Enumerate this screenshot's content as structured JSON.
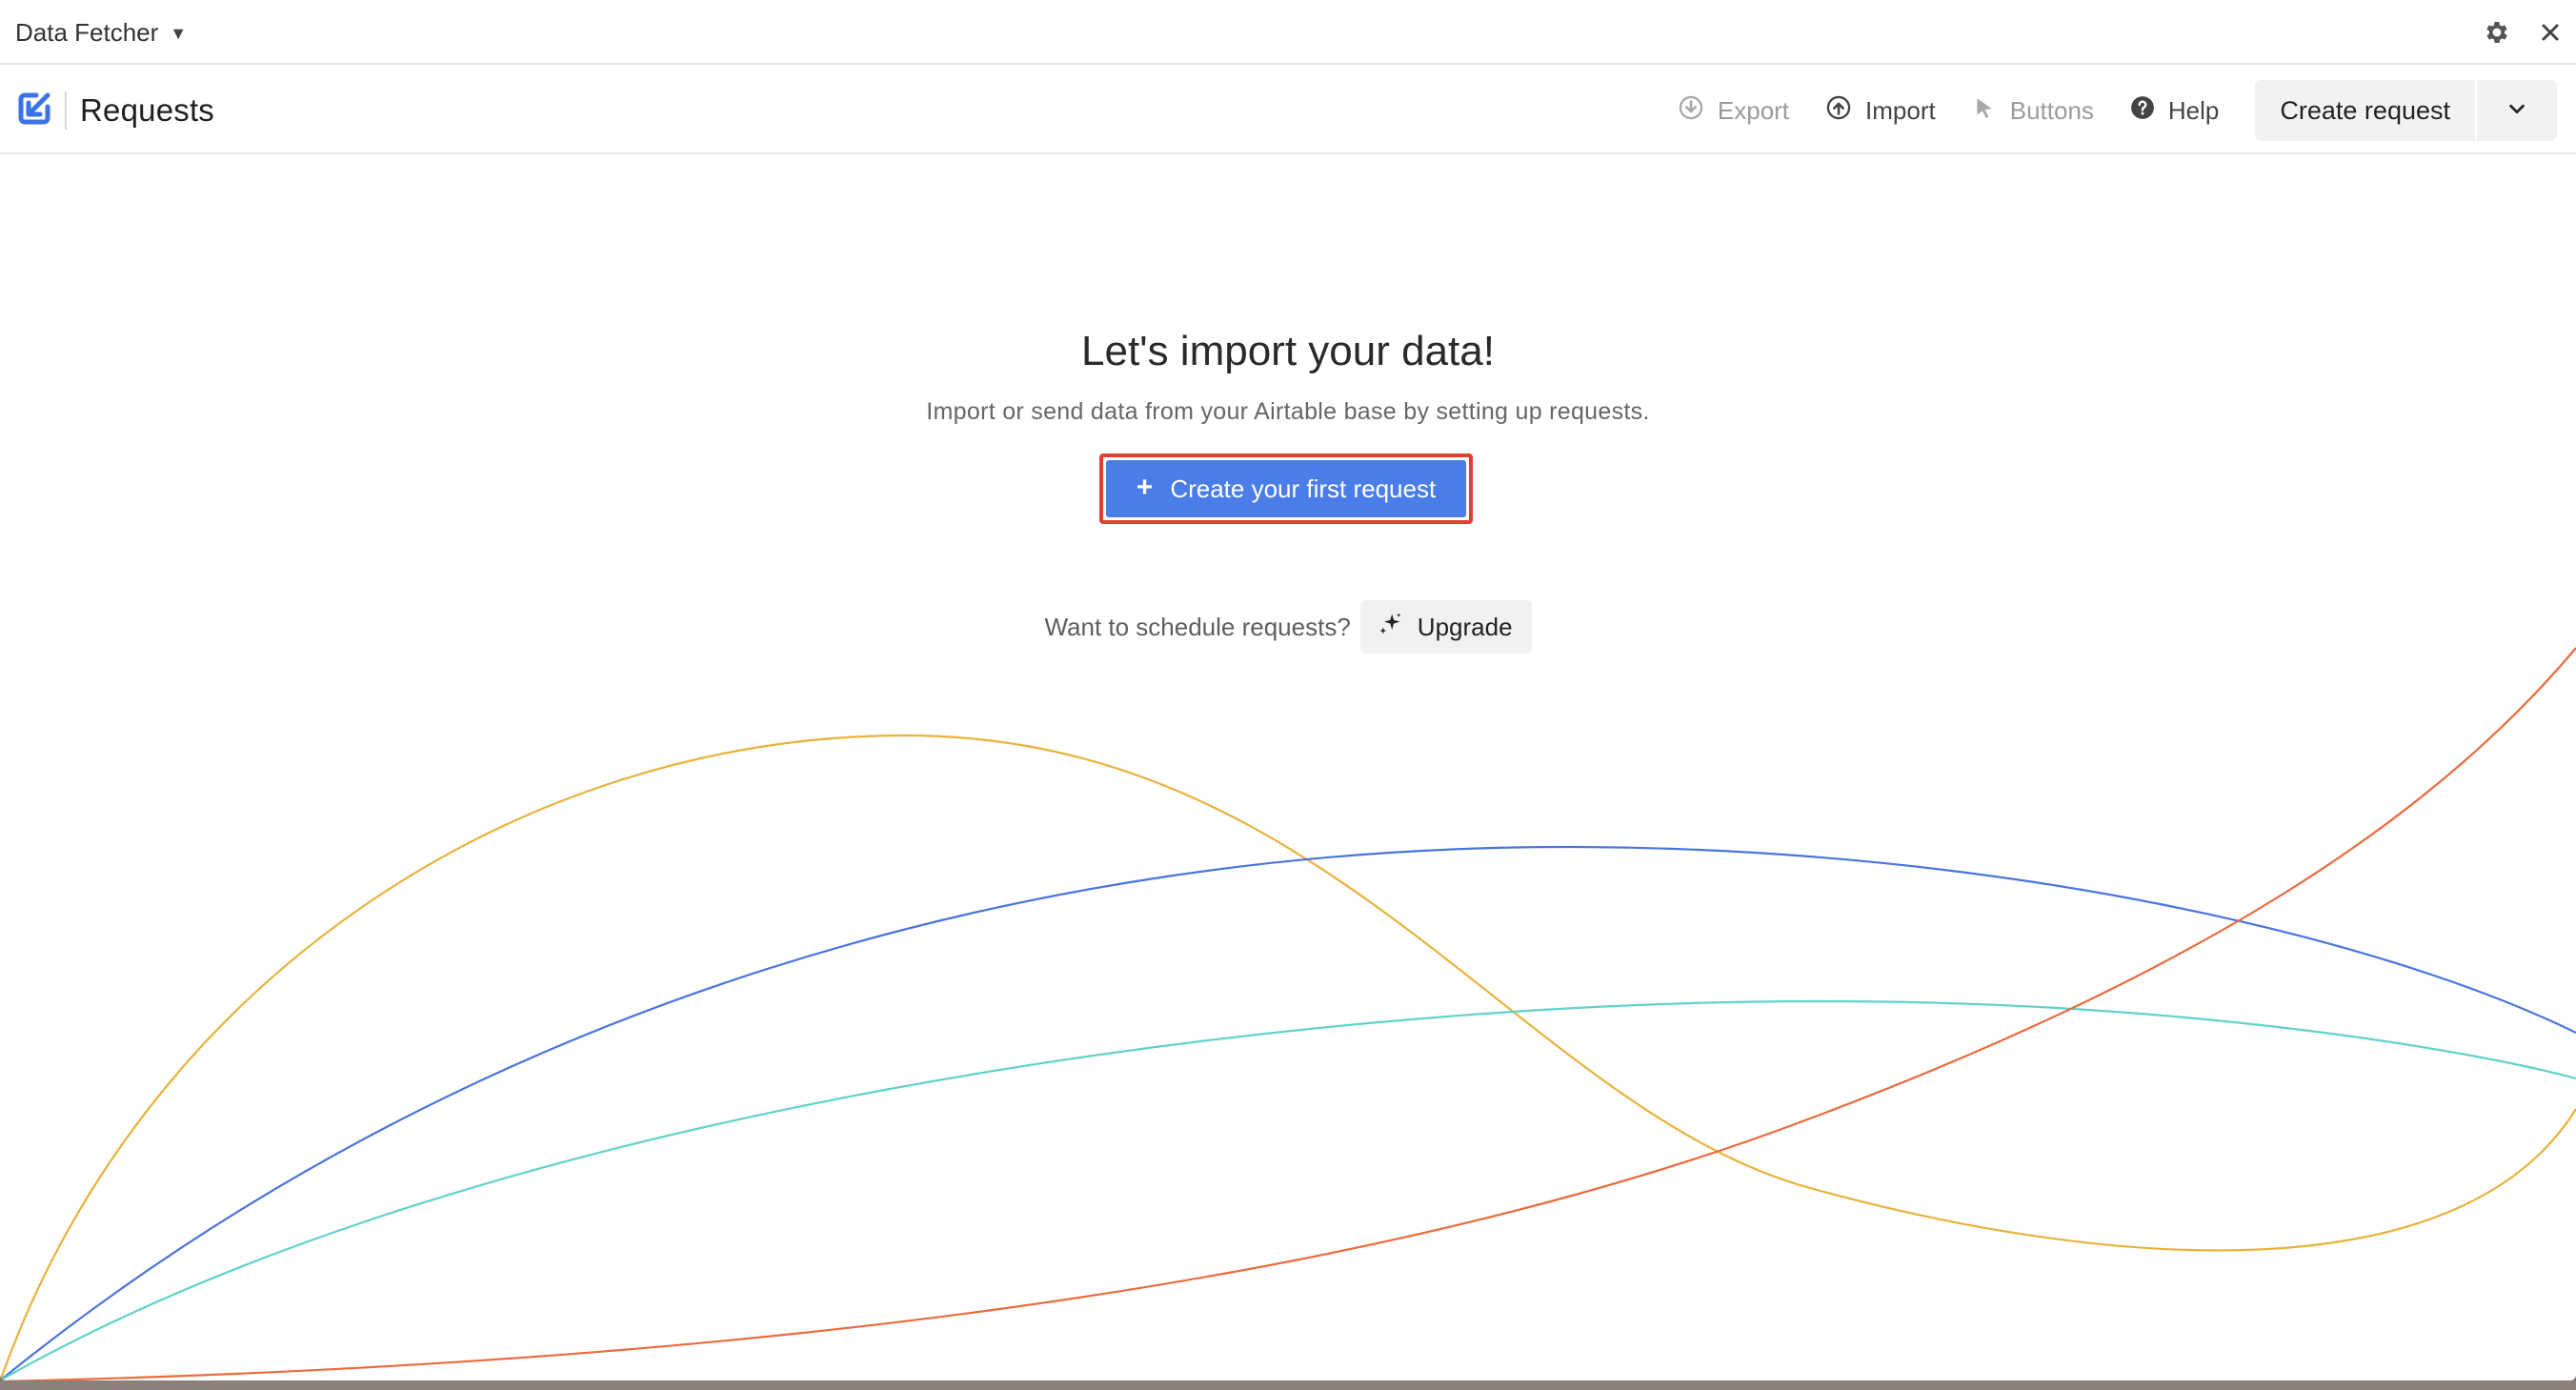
{
  "titlebar": {
    "app_name": "Data Fetcher"
  },
  "header": {
    "title": "Requests",
    "toolbar": {
      "export_label": "Export",
      "import_label": "Import",
      "buttons_label": "Buttons",
      "help_label": "Help",
      "create_request_label": "Create request"
    }
  },
  "empty_state": {
    "title": "Let's import your data!",
    "subtitle": "Import or send data from your Airtable base by setting up requests.",
    "primary_button_label": "Create your first request",
    "schedule_prompt": "Want to schedule requests?",
    "upgrade_label": "Upgrade"
  },
  "colors": {
    "accent": "#4a7de8",
    "highlight_border": "#e0412f",
    "curve_yellow": "#e9b23a",
    "curve_blue": "#4a74e0",
    "curve_teal": "#5fd3c9",
    "curve_orange": "#ec6a3c"
  },
  "icons": {
    "brand": "data-fetcher-logo-icon",
    "settings": "gear-icon",
    "close": "close-icon",
    "export": "download-circle-icon",
    "import": "upload-circle-icon",
    "buttons": "cursor-icon",
    "help": "help-circle-icon",
    "dropdown": "chevron-down-icon",
    "upgrade": "sparkle-icon"
  }
}
